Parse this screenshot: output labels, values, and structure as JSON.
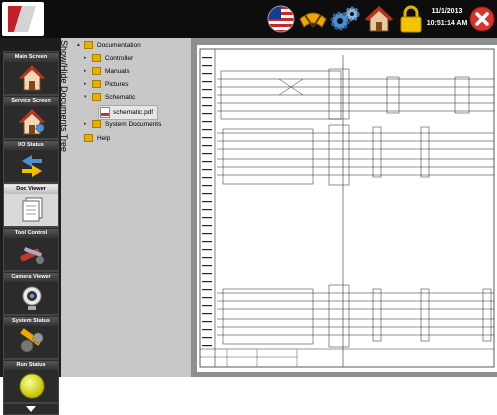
{
  "topbar": {
    "date": "11/1/2013",
    "time": "10:51:14 AM",
    "icons": [
      "us-flag-icon",
      "windshield-wiper-icon",
      "gears-icon",
      "home-icon",
      "lock-icon",
      "close-icon"
    ]
  },
  "nav": {
    "items": [
      {
        "label": "Main Screen",
        "icon": "home-icon"
      },
      {
        "label": "Service Screen",
        "icon": "service-home-icon"
      },
      {
        "label": "I/O Status",
        "icon": "io-arrows-icon"
      },
      {
        "label": "Doc Viewer",
        "icon": "documents-icon"
      },
      {
        "label": "Tool Control",
        "icon": "tools-icon"
      },
      {
        "label": "Camera Viewer",
        "icon": "camera-icon"
      },
      {
        "label": "System Status",
        "icon": "system-status-icon"
      },
      {
        "label": "Run Status",
        "icon": "run-status-icon"
      }
    ],
    "active_index": 3,
    "active_color": "#d9d9d9"
  },
  "tree": {
    "toggle_label": "Show/Hide Documents Tree",
    "items": [
      {
        "label": "Documentation",
        "type": "folder",
        "expanded": true
      },
      {
        "label": "Controller",
        "type": "folder",
        "expanded": false
      },
      {
        "label": "Manuals",
        "type": "folder",
        "expanded": false
      },
      {
        "label": "Pictures",
        "type": "folder",
        "expanded": false
      },
      {
        "label": "Schematic",
        "type": "folder",
        "expanded": true,
        "selected": true
      },
      {
        "label": "schematic.pdf",
        "type": "pdf"
      },
      {
        "label": "System Documents",
        "type": "folder",
        "expanded": false
      },
      {
        "label": "Help",
        "type": "folder"
      }
    ]
  },
  "viewer": {
    "document": "schematic.pdf"
  }
}
